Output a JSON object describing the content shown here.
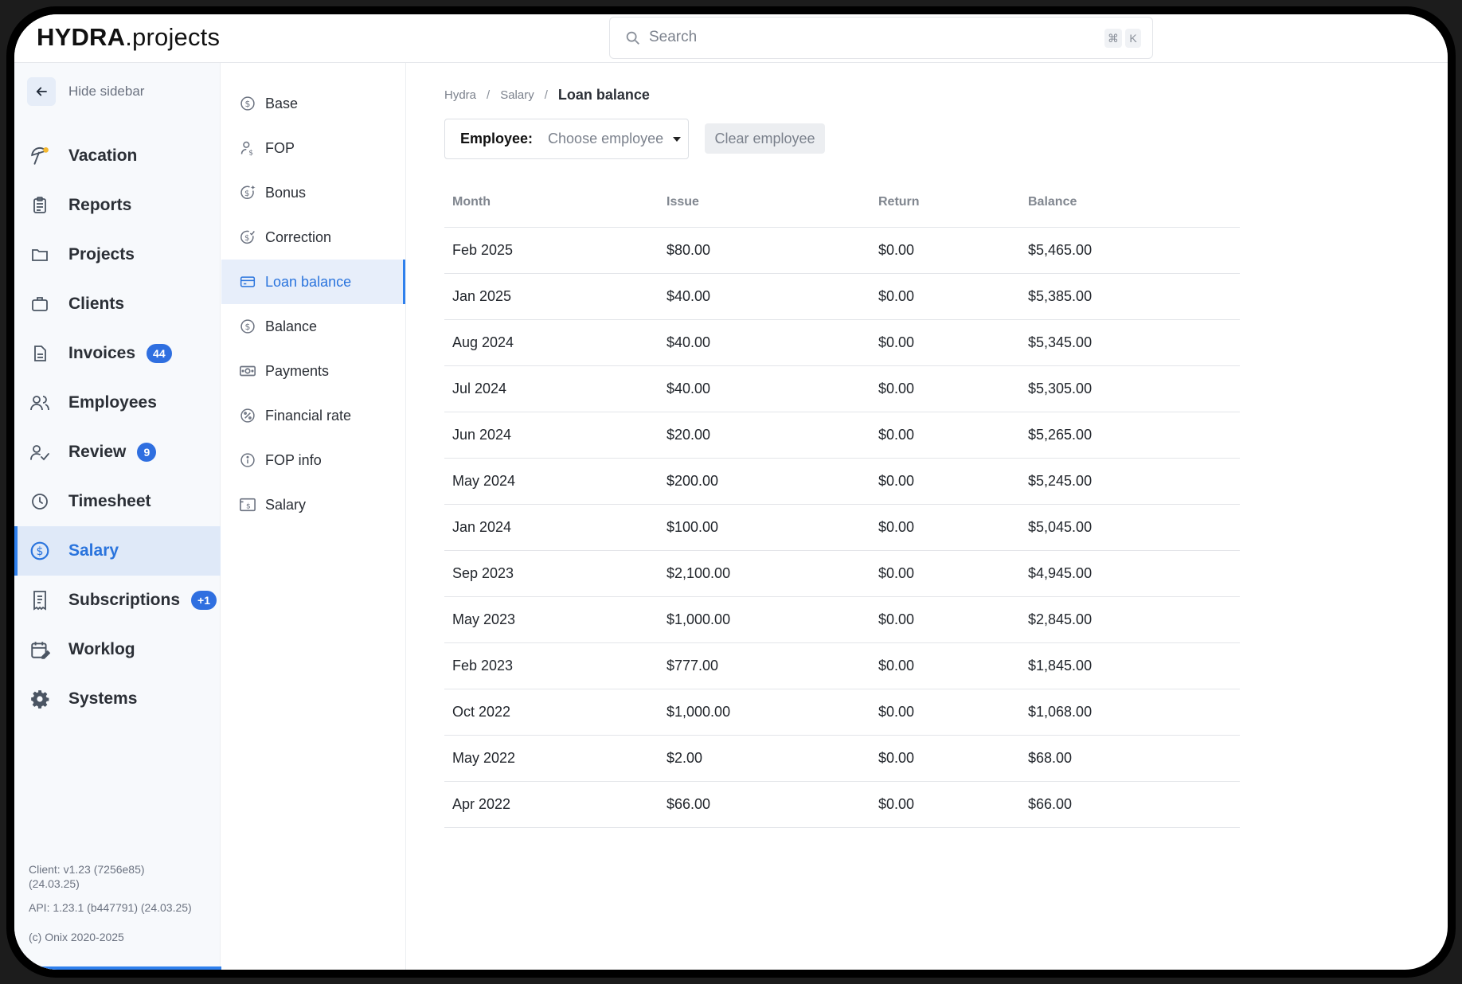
{
  "app": {
    "brand_bold": "HYDRA",
    "brand_rest": ".projects"
  },
  "search": {
    "placeholder": "Search",
    "shortcut_mod": "⌘",
    "shortcut_key": "K"
  },
  "sidebar": {
    "hide_label": "Hide sidebar",
    "items": [
      {
        "label": "Vacation",
        "icon": "umbrella-icon"
      },
      {
        "label": "Reports",
        "icon": "clipboard-icon"
      },
      {
        "label": "Projects",
        "icon": "folder-icon"
      },
      {
        "label": "Clients",
        "icon": "briefcase-icon"
      },
      {
        "label": "Invoices",
        "icon": "document-icon",
        "badge": "44"
      },
      {
        "label": "Employees",
        "icon": "users-icon"
      },
      {
        "label": "Review",
        "icon": "user-check-icon",
        "badge": "9"
      },
      {
        "label": "Timesheet",
        "icon": "clock-icon"
      },
      {
        "label": "Salary",
        "icon": "dollar-circle-icon",
        "active": true
      },
      {
        "label": "Subscriptions",
        "icon": "receipt-icon",
        "badge": "+1"
      },
      {
        "label": "Worklog",
        "icon": "calendar-edit-icon"
      },
      {
        "label": "Systems",
        "icon": "gear-icon"
      }
    ],
    "footer": {
      "client_version_line1": "Client: v1.23 (7256e85)",
      "client_version_line2": "(24.03.25)",
      "api_version": "API: 1.23.1 (b447791) (24.03.25)",
      "copyright": "(c) Onix 2020-2025"
    }
  },
  "subnav": {
    "items": [
      {
        "label": "Base",
        "icon": "dollar-circle-icon"
      },
      {
        "label": "FOP",
        "icon": "user-dollar-icon"
      },
      {
        "label": "Bonus",
        "icon": "dollar-star-icon"
      },
      {
        "label": "Correction",
        "icon": "dollar-check-icon"
      },
      {
        "label": "Loan balance",
        "icon": "card-icon",
        "active": true
      },
      {
        "label": "Balance",
        "icon": "dollar-circle-icon"
      },
      {
        "label": "Payments",
        "icon": "banknote-icon"
      },
      {
        "label": "Financial rate",
        "icon": "percent-icon"
      },
      {
        "label": "FOP info",
        "icon": "info-icon"
      },
      {
        "label": "Salary",
        "icon": "salary-doc-icon"
      }
    ]
  },
  "breadcrumb": {
    "items": [
      "Hydra",
      "Salary"
    ],
    "current": "Loan balance"
  },
  "filter": {
    "employee_label": "Employee:",
    "employee_value": "Choose employee",
    "clear_label": "Clear employee"
  },
  "table": {
    "headers": [
      "Month",
      "Issue",
      "Return",
      "Balance"
    ],
    "rows": [
      [
        "Feb 2025",
        "$80.00",
        "$0.00",
        "$5,465.00"
      ],
      [
        "Jan 2025",
        "$40.00",
        "$0.00",
        "$5,385.00"
      ],
      [
        "Aug 2024",
        "$40.00",
        "$0.00",
        "$5,345.00"
      ],
      [
        "Jul 2024",
        "$40.00",
        "$0.00",
        "$5,305.00"
      ],
      [
        "Jun 2024",
        "$20.00",
        "$0.00",
        "$5,265.00"
      ],
      [
        "May 2024",
        "$200.00",
        "$0.00",
        "$5,245.00"
      ],
      [
        "Jan 2024",
        "$100.00",
        "$0.00",
        "$5,045.00"
      ],
      [
        "Sep 2023",
        "$2,100.00",
        "$0.00",
        "$4,945.00"
      ],
      [
        "May 2023",
        "$1,000.00",
        "$0.00",
        "$2,845.00"
      ],
      [
        "Feb 2023",
        "$777.00",
        "$0.00",
        "$1,845.00"
      ],
      [
        "Oct 2022",
        "$1,000.00",
        "$0.00",
        "$1,068.00"
      ],
      [
        "May 2022",
        "$2.00",
        "$0.00",
        "$68.00"
      ],
      [
        "Apr 2022",
        "$66.00",
        "$0.00",
        "$66.00"
      ]
    ]
  },
  "colors": {
    "accent": "#2f80ed",
    "active_bg": "#dfe9f8",
    "badge": "#2f6fe0"
  }
}
